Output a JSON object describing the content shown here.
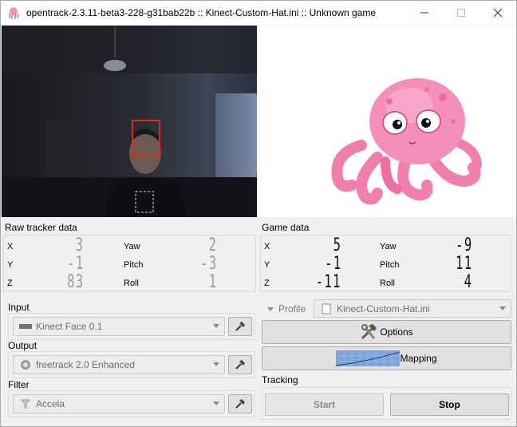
{
  "window": {
    "title": "opentrack-2.3.11-beta3-228-g31bab22b :: Kinect-Custom-Hat.ini :: Unknown game"
  },
  "raw_tracker": {
    "label": "Raw tracker data",
    "x_label": "X",
    "x_value": "3",
    "y_label": "Y",
    "y_value": "-1",
    "z_label": "Z",
    "z_value": "83",
    "yaw_label": "Yaw",
    "yaw_value": "2",
    "pitch_label": "Pitch",
    "pitch_value": "-3",
    "roll_label": "Roll",
    "roll_value": "1"
  },
  "game_data": {
    "label": "Game data",
    "x_label": "X",
    "x_value": "5",
    "y_label": "Y",
    "y_value": "-1",
    "z_label": "Z",
    "z_value": "-11",
    "yaw_label": "Yaw",
    "yaw_value": "-9",
    "pitch_label": "Pitch",
    "pitch_value": "11",
    "roll_label": "Roll",
    "roll_value": "4"
  },
  "input": {
    "label": "Input",
    "selected": "Kinect Face 0.1"
  },
  "output": {
    "label": "Output",
    "selected": "freetrack 2.0 Enhanced"
  },
  "filter": {
    "label": "Filter",
    "selected": "Accela"
  },
  "profile": {
    "label": "Profile",
    "selected": "Kinect-Custom-Hat.ini"
  },
  "buttons": {
    "options": "Options",
    "mapping": "Mapping"
  },
  "tracking": {
    "label": "Tracking",
    "start": "Start",
    "stop": "Stop"
  },
  "colors": {
    "face_box": "#e0261f",
    "octopus": "#f48fb9",
    "accent": "#0078d7"
  }
}
